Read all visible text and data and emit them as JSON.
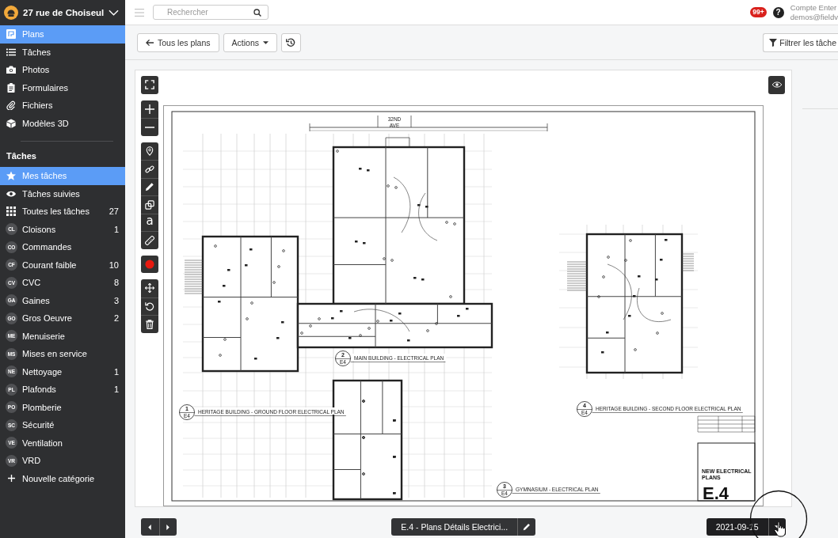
{
  "sidebar": {
    "project": {
      "name": "27 rue de Choiseul"
    },
    "nav": [
      {
        "kind": "plans",
        "label": "Plans",
        "selected": true
      },
      {
        "kind": "tasks",
        "label": "Tâches",
        "selected": false
      },
      {
        "kind": "photos",
        "label": "Photos",
        "selected": false
      },
      {
        "kind": "forms",
        "label": "Formulaires",
        "selected": false
      },
      {
        "kind": "files",
        "label": "Fichiers",
        "selected": false
      },
      {
        "kind": "models",
        "label": "Modèles 3D",
        "selected": false
      }
    ],
    "section_title": "Tâches",
    "task_lists": [
      {
        "kind": "mine",
        "label": "Mes tâches",
        "selected": true
      },
      {
        "kind": "followed",
        "label": "Tâches suivies",
        "selected": false
      },
      {
        "kind": "all",
        "label": "Toutes les tâches",
        "count": "27",
        "selected": false
      },
      {
        "kind": "category",
        "abbr": "CL",
        "label": "Cloisons",
        "count": "1",
        "selected": false
      },
      {
        "kind": "category",
        "abbr": "CO",
        "label": "Commandes",
        "selected": false
      },
      {
        "kind": "category",
        "abbr": "CF",
        "label": "Courant faible",
        "count": "10",
        "selected": false
      },
      {
        "kind": "category",
        "abbr": "CV",
        "label": "CVC",
        "count": "8",
        "selected": false
      },
      {
        "kind": "category",
        "abbr": "GA",
        "label": "Gaines",
        "count": "3",
        "selected": false
      },
      {
        "kind": "category",
        "abbr": "GO",
        "label": "Gros Oeuvre",
        "count": "2",
        "selected": false
      },
      {
        "kind": "category",
        "abbr": "ME",
        "label": "Menuiserie",
        "selected": false
      },
      {
        "kind": "category",
        "abbr": "MS",
        "label": "Mises en service",
        "selected": false
      },
      {
        "kind": "category",
        "abbr": "NE",
        "label": "Nettoyage",
        "count": "1",
        "selected": false
      },
      {
        "kind": "category",
        "abbr": "PL",
        "label": "Plafonds",
        "count": "1",
        "selected": false
      },
      {
        "kind": "category",
        "abbr": "PO",
        "label": "Plomberie",
        "selected": false
      },
      {
        "kind": "category",
        "abbr": "SC",
        "label": "Sécurité",
        "selected": false
      },
      {
        "kind": "category",
        "abbr": "VE",
        "label": "Ventilation",
        "selected": false
      },
      {
        "kind": "category",
        "abbr": "VR",
        "label": "VRD",
        "selected": false
      },
      {
        "kind": "add",
        "label": "Nouvelle catégorie",
        "selected": false
      }
    ]
  },
  "top_bar": {
    "search": {
      "placeholder": "Rechercher"
    },
    "notifications": {
      "badge": "99+"
    },
    "help": {
      "glyph": "?"
    },
    "account": {
      "name": "Compte Enter",
      "email": "demos@fieldv"
    }
  },
  "toolbar": {
    "back_button": "Tous les plans",
    "actions_button": "Actions",
    "filter_button": "Filtrer les tâche"
  },
  "viewer": {
    "tool_groups": [
      {
        "tools": [
          {
            "kind": "fullscreen"
          }
        ]
      },
      {
        "tools": [
          {
            "kind": "zoom_in"
          },
          {
            "kind": "zoom_out"
          }
        ]
      },
      {
        "tools": [
          {
            "kind": "pin"
          },
          {
            "kind": "link"
          },
          {
            "kind": "pencil"
          },
          {
            "kind": "shapes"
          },
          {
            "kind": "text",
            "glyph": "a"
          },
          {
            "kind": "ruler"
          }
        ]
      },
      {
        "tools": [
          {
            "kind": "record"
          }
        ]
      },
      {
        "tools": [
          {
            "kind": "move"
          },
          {
            "kind": "rotate"
          },
          {
            "kind": "delete"
          }
        ]
      }
    ],
    "plan": {
      "street_label": [
        "32ND",
        "AVE"
      ],
      "captions": [
        {
          "number": "1",
          "sheet": "E4",
          "title": "HERITAGE BUILDING - GROUND FLOOR ELECTRICAL PLAN"
        },
        {
          "number": "2",
          "sheet": "E4",
          "title": "MAIN BUILDING - ELECTRICAL PLAN"
        },
        {
          "number": "3",
          "sheet": "E4",
          "title": "GYMNASIUM - ELECTRICAL PLAN"
        },
        {
          "number": "4",
          "sheet": "E4",
          "title": "HERITAGE BUILDING - SECOND FLOOR ELECTRICAL PLAN"
        }
      ],
      "title_block": {
        "title_lines": [
          "NEW ELECTRICAL",
          "PLANS"
        ],
        "sheet": "E.4"
      }
    }
  },
  "bottom_bar": {
    "sheet_button": "E.4 - Plans Détails Electrici...",
    "date": "2021-09-15"
  }
}
